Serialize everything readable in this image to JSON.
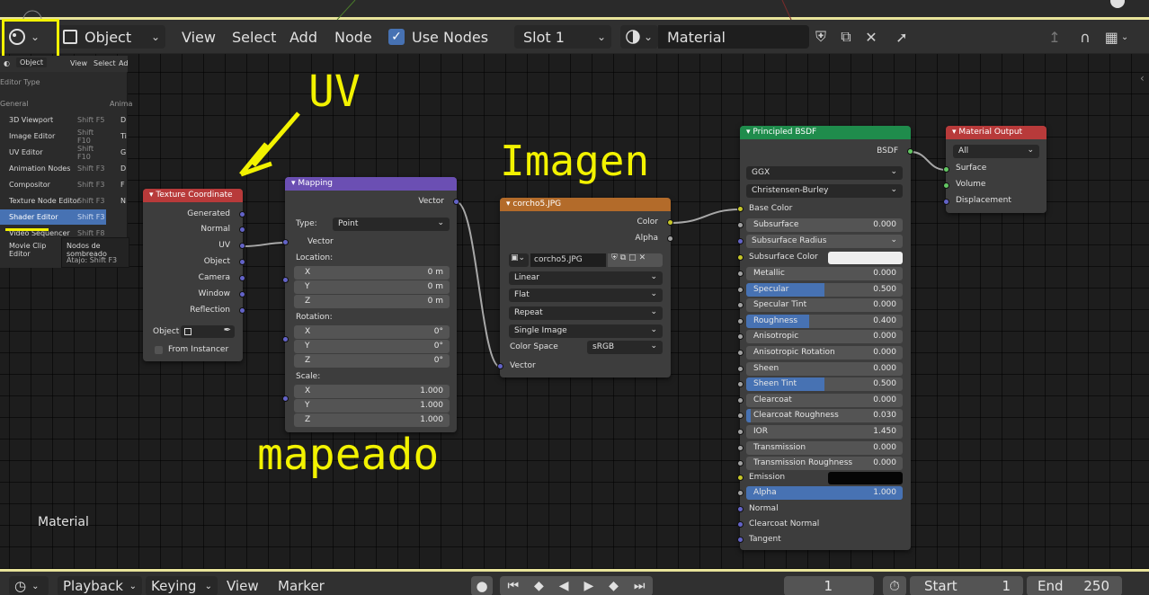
{
  "header": {
    "editor_type_icon": "node-editor-icon",
    "object_mode": "Object",
    "menus": [
      "View",
      "Select",
      "Add",
      "Node"
    ],
    "use_nodes_label": "Use Nodes",
    "slot": "Slot 1",
    "material_name": "Material"
  },
  "editor_popup": {
    "mini_header": {
      "mode": "Object",
      "view": "View",
      "select": "Select",
      "add": "Ad"
    },
    "title": "Editor Type",
    "section_general": "General",
    "section_anim": "Anima",
    "items": [
      {
        "label": "3D Viewport",
        "shortcut": "Shift F5"
      },
      {
        "label": "Image Editor",
        "shortcut": "Shift F10"
      },
      {
        "label": "UV Editor",
        "shortcut": "Shift F10"
      },
      {
        "label": "Animation Nodes",
        "shortcut": "Shift F3"
      },
      {
        "label": "Compositor",
        "shortcut": "Shift F3"
      },
      {
        "label": "Texture Node Editor",
        "shortcut": "Shift F3"
      },
      {
        "label": "Shader Editor",
        "shortcut": "Shift F3"
      },
      {
        "label": "Video Sequencer",
        "shortcut": "Shift F8"
      },
      {
        "label": "Movie Clip Editor",
        "shortcut": "Shift F2"
      }
    ],
    "right_col": [
      "D",
      "Ti",
      "G",
      "D",
      "F",
      "N"
    ],
    "tooltip": {
      "line1": "Nodos de sombreado",
      "line2": "Atajo: Shift F3"
    }
  },
  "nodes": {
    "texcoord": {
      "title": "Texture Coordinate",
      "outputs": [
        "Generated",
        "Normal",
        "UV",
        "Object",
        "Camera",
        "Window",
        "Reflection"
      ],
      "object_label": "Object",
      "from_instancer": "From Instancer"
    },
    "mapping": {
      "title": "Mapping",
      "output": "Vector",
      "type_label": "Type:",
      "type_value": "Point",
      "vector_input": "Vector",
      "location_label": "Location:",
      "location": [
        {
          "axis": "X",
          "value": "0 m"
        },
        {
          "axis": "Y",
          "value": "0 m"
        },
        {
          "axis": "Z",
          "value": "0 m"
        }
      ],
      "rotation_label": "Rotation:",
      "rotation": [
        {
          "axis": "X",
          "value": "0°"
        },
        {
          "axis": "Y",
          "value": "0°"
        },
        {
          "axis": "Z",
          "value": "0°"
        }
      ],
      "scale_label": "Scale:",
      "scale": [
        {
          "axis": "X",
          "value": "1.000"
        },
        {
          "axis": "Y",
          "value": "1.000"
        },
        {
          "axis": "Z",
          "value": "1.000"
        }
      ]
    },
    "image": {
      "title": "corcho5.JPG",
      "out_color": "Color",
      "out_alpha": "Alpha",
      "image_name": "corcho5.JPG",
      "interpolation": "Linear",
      "projection": "Flat",
      "extension": "Repeat",
      "source": "Single Image",
      "color_space_label": "Color Space",
      "color_space": "sRGB",
      "vector_input": "Vector"
    },
    "bsdf": {
      "title": "Principled BSDF",
      "output": "BSDF",
      "distribution": "GGX",
      "subsurface_method": "Christensen-Burley",
      "base_color": "Base Color",
      "subsurface": {
        "label": "Subsurface",
        "value": "0.000"
      },
      "subsurface_radius": "Subsurface Radius",
      "subsurface_color": "Subsurface Color",
      "params": [
        {
          "label": "Metallic",
          "value": "0.000",
          "fill": 0
        },
        {
          "label": "Specular",
          "value": "0.500",
          "fill": 0.5
        },
        {
          "label": "Specular Tint",
          "value": "0.000",
          "fill": 0
        },
        {
          "label": "Roughness",
          "value": "0.400",
          "fill": 0.4
        },
        {
          "label": "Anisotropic",
          "value": "0.000",
          "fill": 0
        },
        {
          "label": "Anisotropic Rotation",
          "value": "0.000",
          "fill": 0
        },
        {
          "label": "Sheen",
          "value": "0.000",
          "fill": 0
        },
        {
          "label": "Sheen Tint",
          "value": "0.500",
          "fill": 0.5
        },
        {
          "label": "Clearcoat",
          "value": "0.000",
          "fill": 0
        },
        {
          "label": "Clearcoat Roughness",
          "value": "0.030",
          "fill": 0.03
        },
        {
          "label": "IOR",
          "value": "1.450",
          "fill": 0
        },
        {
          "label": "Transmission",
          "value": "0.000",
          "fill": 0
        },
        {
          "label": "Transmission Roughness",
          "value": "0.000",
          "fill": 0
        }
      ],
      "emission": "Emission",
      "alpha": {
        "label": "Alpha",
        "value": "1.000",
        "fill": 1
      },
      "normal": "Normal",
      "clearcoat_normal": "Clearcoat Normal",
      "tangent": "Tangent"
    },
    "output": {
      "title": "Material Output",
      "target": "All",
      "inputs": [
        "Surface",
        "Volume",
        "Displacement"
      ]
    }
  },
  "annotations": {
    "uv": "UV",
    "imagen": "Imagen",
    "mapeado": "mapeado"
  },
  "overlay_label": "Material",
  "timeline": {
    "playback": "Playback",
    "keying": "Keying",
    "view": "View",
    "marker": "Marker",
    "current_frame": "1",
    "start_label": "Start",
    "start_value": "1",
    "end_label": "End",
    "end_value": "250"
  },
  "colors": {
    "accent": "#4772b3",
    "annotation": "#f2f200",
    "header_texcoord": "#b83a3a",
    "header_mapping": "#6b4fb3",
    "header_image": "#b36b2a",
    "header_bsdf": "#1f8c4c",
    "header_output": "#b83a3a",
    "frame_border": "#e8e39a"
  }
}
